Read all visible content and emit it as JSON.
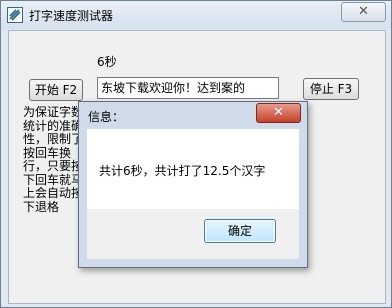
{
  "window": {
    "title": "打字速度测试器",
    "close_glyph": "✕"
  },
  "main": {
    "time_label": "6秒",
    "start_button": "开始 F2",
    "stop_button": "停止 F3",
    "text_display": "东坡下载欢迎你！达到案的",
    "instructions": [
      "为保证字数",
      "统计的准确",
      "性，限制了",
      "按回车换",
      "行，只要按",
      "下回车就马",
      "上会自动按",
      "下退格"
    ]
  },
  "dialog": {
    "title": "信息：",
    "close_glyph": "✕",
    "message": "共计6秒，共计打了12.5个汉字",
    "ok_button": "确定"
  },
  "colors": {
    "dialog_close": "#c7422c",
    "ok_border": "#3c7fb1"
  },
  "icons": {
    "app": "app-logo-icon",
    "close": "close-icon"
  }
}
